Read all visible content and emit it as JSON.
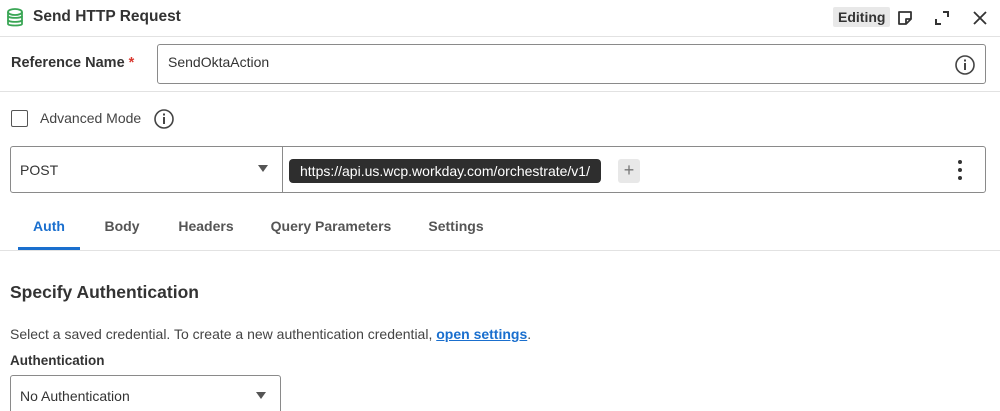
{
  "header": {
    "title": "Send HTTP Request",
    "status_badge": "Editing",
    "icons": [
      "database-icon",
      "note-icon",
      "expand-icon",
      "close-icon"
    ],
    "accent_color": "#3aa655"
  },
  "reference": {
    "label": "Reference Name",
    "required_marker": "*",
    "value": "SendOktaAction"
  },
  "advanced_mode": {
    "label": "Advanced Mode",
    "checked": false
  },
  "request": {
    "method": "POST",
    "url_segment": "https://api.us.wcp.workday.com/orchestrate/v1/",
    "add_label": "+"
  },
  "tabs": [
    {
      "label": "Auth",
      "active": true
    },
    {
      "label": "Body",
      "active": false
    },
    {
      "label": "Headers",
      "active": false
    },
    {
      "label": "Query Parameters",
      "active": false
    },
    {
      "label": "Settings",
      "active": false
    }
  ],
  "auth_section": {
    "title": "Specify Authentication",
    "description_prefix": "Select a saved credential. To create a new authentication credential, ",
    "description_link": "open settings",
    "description_suffix": ".",
    "field_label": "Authentication",
    "selected": "No Authentication"
  },
  "colors": {
    "link": "#1a6fce",
    "required": "#d9382f",
    "pill_bg": "#2e2e2e"
  }
}
